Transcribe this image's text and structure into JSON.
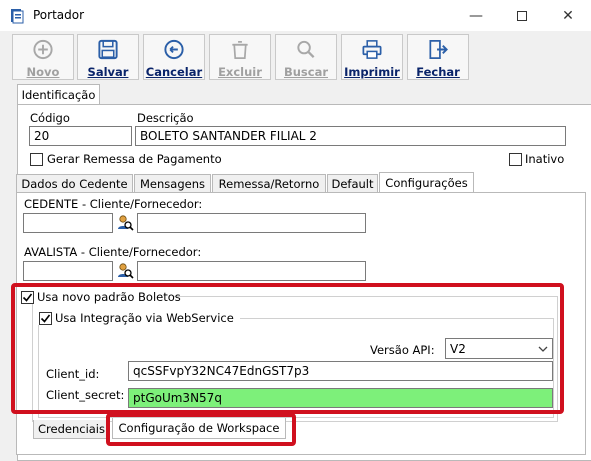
{
  "window": {
    "title": "Portador"
  },
  "toolbar": {
    "novo": "Novo",
    "salvar": "Salvar",
    "cancelar": "Cancelar",
    "excluir": "Excluir",
    "buscar": "Buscar",
    "imprimir": "Imprimir",
    "fechar": "Fechar"
  },
  "outer_tab": {
    "label": "Identificação"
  },
  "form": {
    "codigo_label": "Código",
    "codigo_value": "20",
    "descricao_label": "Descrição",
    "descricao_value": "BOLETO SANTANDER FILIAL 2",
    "gerar_remessa_label": "Gerar Remessa de Pagamento",
    "inativo_label": "Inativo"
  },
  "tabs": [
    "Dados do Cedente",
    "Mensagens",
    "Remessa/Retorno",
    "Default",
    "Configurações"
  ],
  "config": {
    "cedente_label": "CEDENTE - Cliente/Fornecedor:",
    "avalista_label": "AVALISTA - Cliente/Fornecedor:",
    "usa_novo_padrao_label": "Usa novo padrão Boletos",
    "usa_integracao_label": "Usa Integração via WebService",
    "versao_api_label": "Versão API:",
    "versao_api_value": "V2",
    "client_id_label": "Client_id:",
    "client_id_value": "qcSSFvpY32NC47EdnGST7p3",
    "client_secret_label": "Client_secret:",
    "client_secret_value": "ptGoUm3N57q"
  },
  "bottom_tabs": [
    "Credenciais",
    "Configuração de Workspace"
  ],
  "colors": {
    "highlight_red": "#d0101e",
    "secret_bg": "#7df07a",
    "link_blue": "#0a246a"
  }
}
